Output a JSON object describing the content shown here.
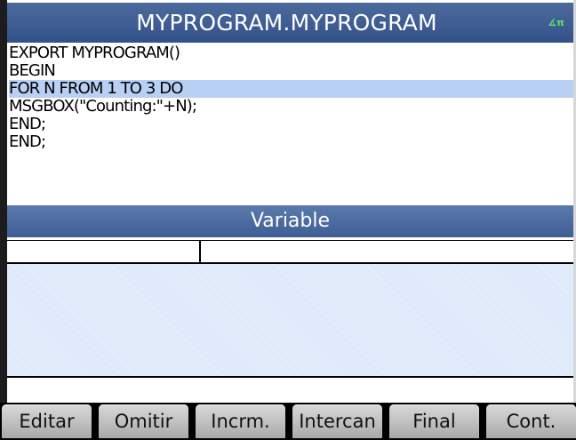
{
  "title": "MYPROGRAM.MYPROGRAM",
  "status_icon": "∡π",
  "code_lines": [
    "EXPORT MYPROGRAM()",
    "BEGIN",
    "FOR N FROM 1 TO 3 DO",
    "MSGBOX(\"Counting:\"+N);",
    "END;",
    "END;"
  ],
  "highlighted_line": 2,
  "variable_panel_title": "Variable",
  "softkeys": [
    "Editar",
    "Omitir",
    "Incrm.",
    "Intercan",
    "Final",
    "Cont."
  ],
  "colors": {
    "titlebar": "#3f5e94",
    "highlight": "#b8d0f4",
    "softkey": "#c4c4c4"
  }
}
